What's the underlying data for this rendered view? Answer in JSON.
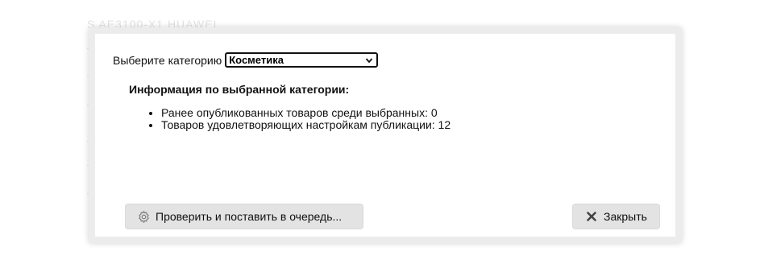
{
  "background": {
    "title_text": "S AE3100-X1 HUAWEI"
  },
  "dialog": {
    "category_label": "Выберите категорию",
    "category_selected": "Косметика",
    "info_title": "Информация по выбранной категории:",
    "info_items": [
      "Ранее опубликованных товаров среди выбранных: 0",
      "Товаров удовлетворяющих настройкам публикации: 12"
    ],
    "check_button_label": "Проверить и поставить в очередь...",
    "close_button_label": "Закрыть"
  },
  "icons": {
    "check_button": "gear-icon",
    "close_button": "close-icon",
    "select_arrow": "chevron-down-icon"
  }
}
